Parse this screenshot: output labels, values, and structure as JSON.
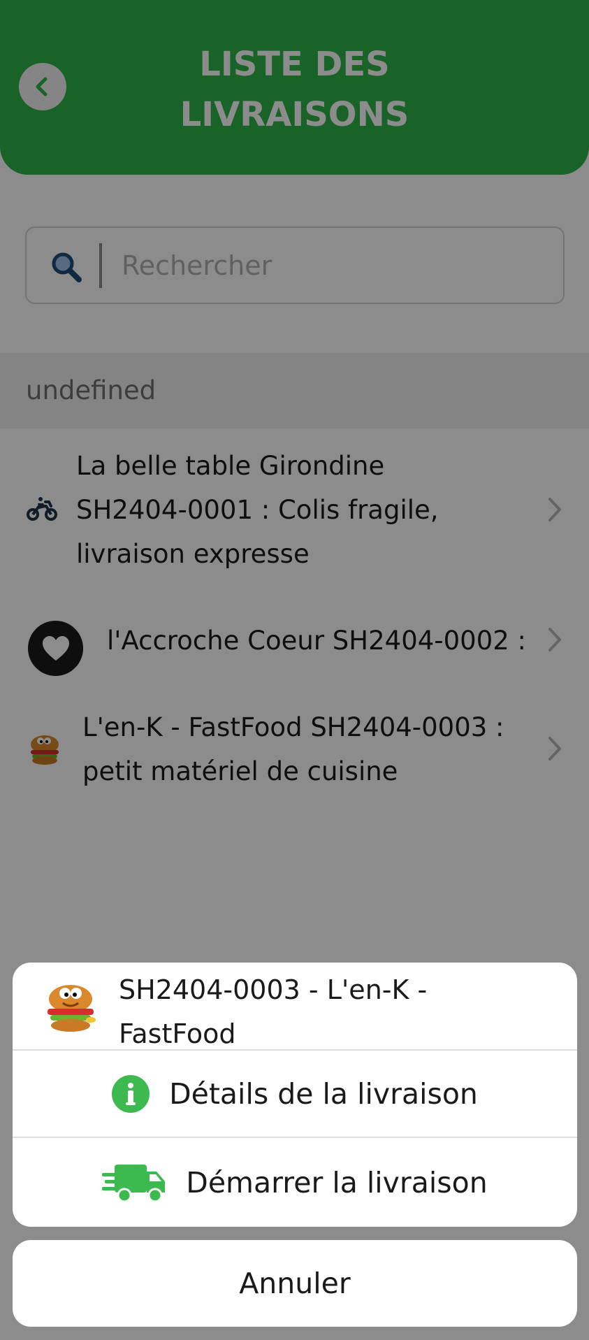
{
  "header": {
    "title_line1": "LISTE DES",
    "title_line2": "LIVRAISONS",
    "back_icon": "chevron-left-icon"
  },
  "search": {
    "placeholder": "Rechercher",
    "value": "",
    "icon": "search-icon"
  },
  "section": {
    "label": "undefined"
  },
  "deliveries": [
    {
      "line1": "La belle table Girondine",
      "line2": "SH2404-0001 : Colis fragile,",
      "line3": "livraison expresse",
      "icon": "motorcycle-icon"
    },
    {
      "line1": "l'Accroche Coeur SH2404-0002 :",
      "icon": "heart-icon"
    },
    {
      "line1": "L'en-K - FastFood SH2404-0003 :",
      "line2": "petit matériel de cuisine",
      "icon": "burger-mascot-icon"
    }
  ],
  "action_sheet": {
    "title_line1": "SH2404-0003 - L'en-K -",
    "title_line2": "FastFood",
    "details_label": "Détails de la livraison",
    "start_label": "Démarrer la livraison",
    "cancel_label": "Annuler"
  },
  "colors": {
    "header_green": "#2eb54a",
    "icon_green": "#3cb94f",
    "overlay": "rgba(0,0,0,0.45)"
  }
}
